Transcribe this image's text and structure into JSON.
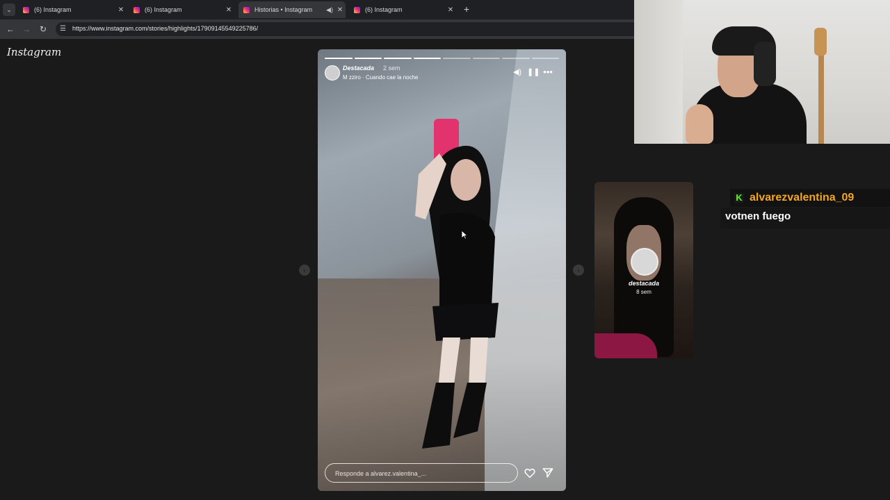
{
  "browser": {
    "tabs": [
      {
        "title": "(6) Instagram",
        "active": false
      },
      {
        "title": "(6) Instagram",
        "active": false
      },
      {
        "title": "Historias • Instagram",
        "active": true
      },
      {
        "title": "(6) Instagram",
        "active": false
      }
    ],
    "url": "https://www.instagram.com/stories/highlights/17909145549225786/"
  },
  "page": {
    "logo": "Instagram"
  },
  "story": {
    "username": "Destacada",
    "time": "2 sem",
    "music": "M zziro · Cuando cae la noche",
    "reply_placeholder": "Responde a alvarez.valentina_...",
    "progress_segments": 8,
    "progress_active_index": 4
  },
  "next_story": {
    "username": "destacada",
    "time": "8 sem"
  },
  "chat": {
    "username": "alvarezvalentina_09",
    "message": "votnen fuego",
    "username_color": "#f5a623",
    "platform_color": "#53fc18"
  },
  "icons": {
    "back": "back-arrow-icon",
    "forward": "forward-arrow-icon",
    "reload": "reload-icon",
    "mute": "speaker-icon",
    "pause": "pause-icon",
    "more": "more-icon",
    "like": "heart-icon",
    "share": "send-icon"
  }
}
